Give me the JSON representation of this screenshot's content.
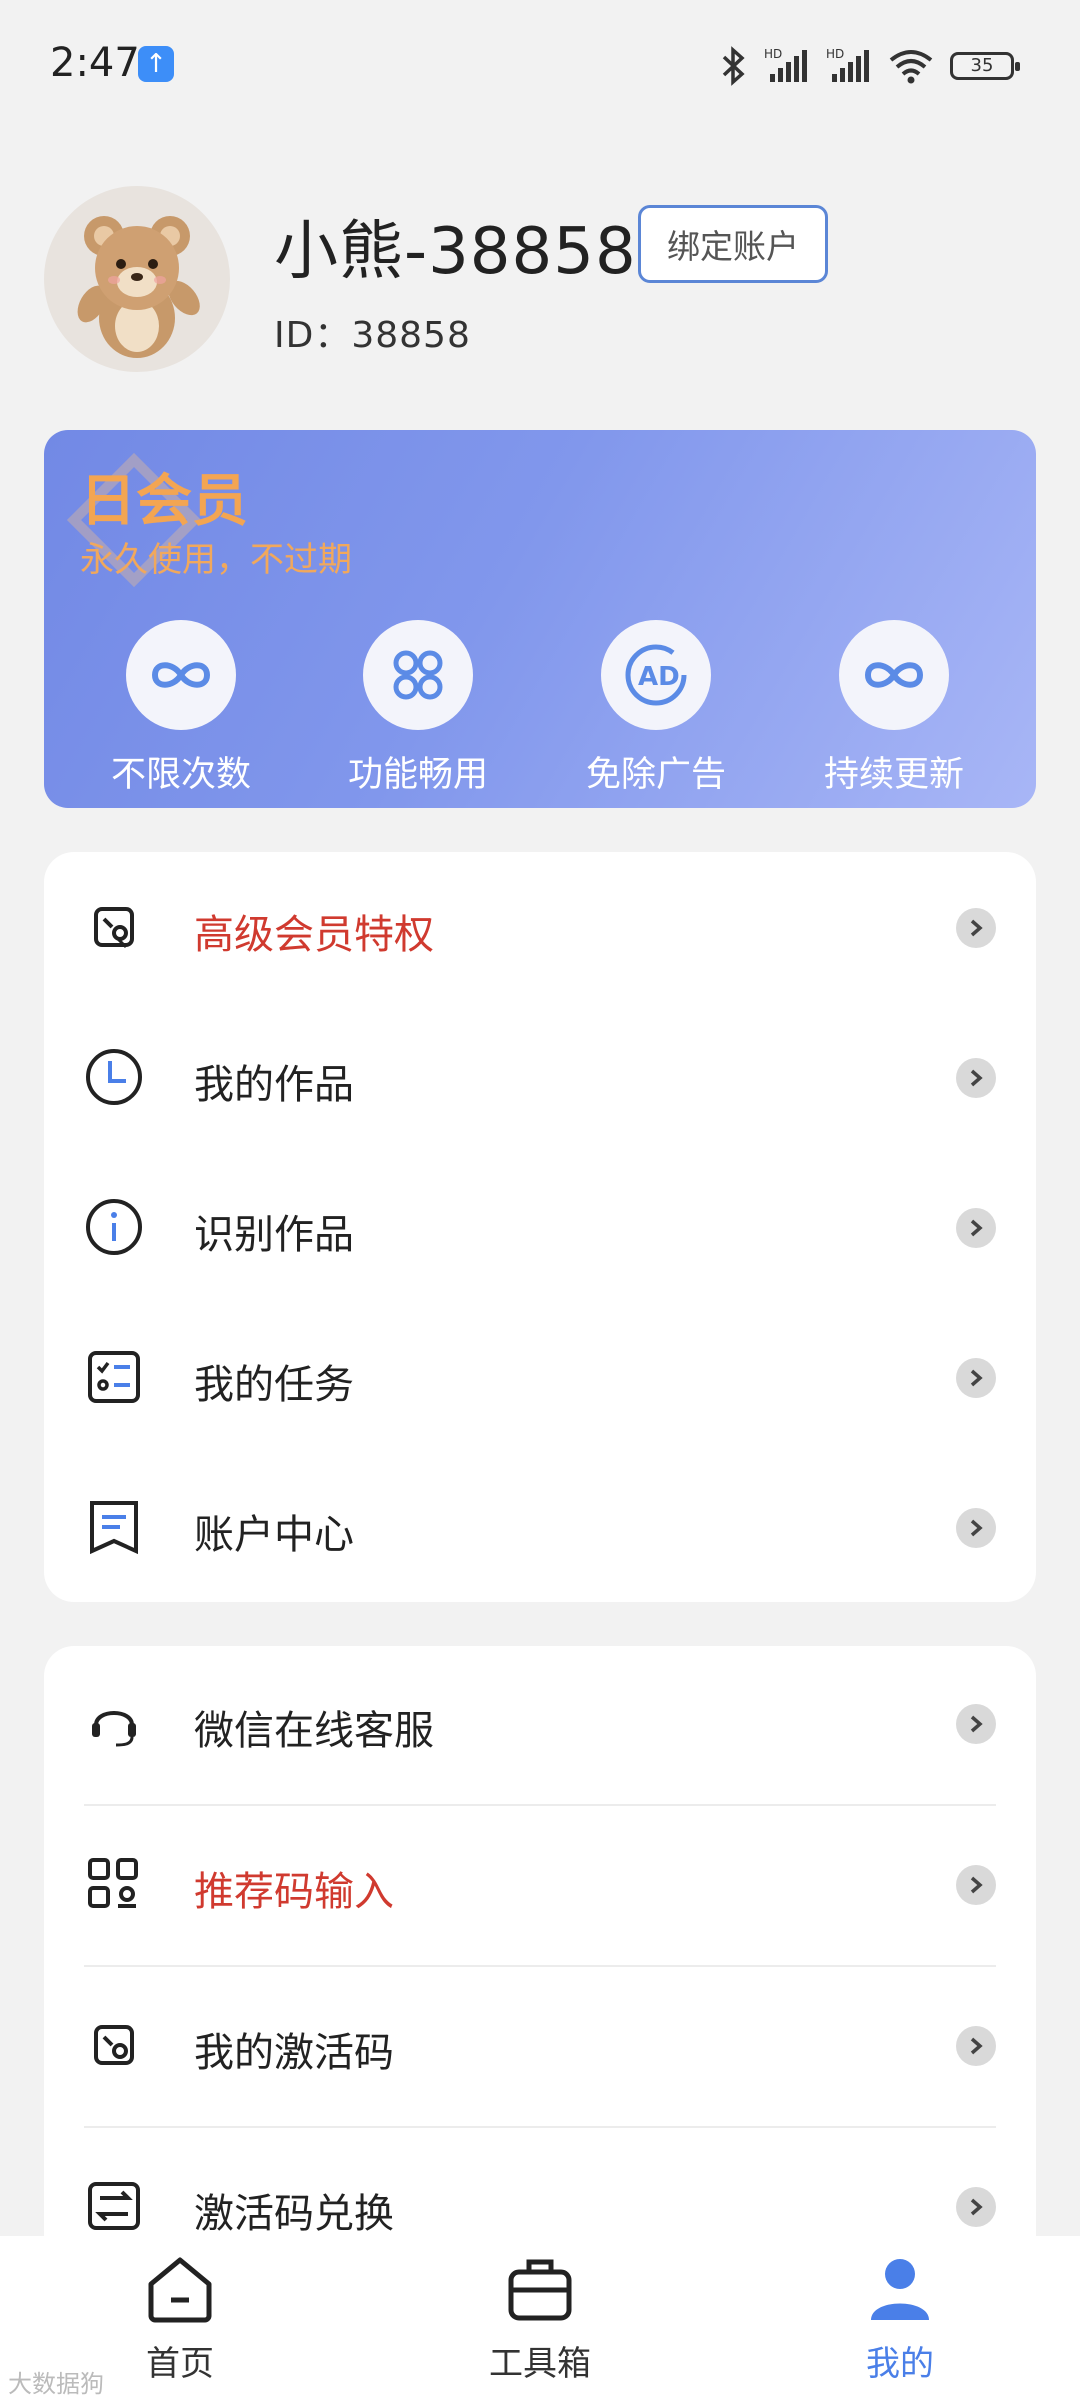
{
  "status_bar": {
    "time": "2:47",
    "battery": "35"
  },
  "profile": {
    "nickname": "小熊-38858",
    "bind_button": "绑定账户",
    "id_text": "ID：38858"
  },
  "vip": {
    "title": "日会员",
    "subtitle": "永久使用，不过期",
    "features": [
      {
        "label": "不限次数",
        "icon": "infinity-icon"
      },
      {
        "label": "功能畅用",
        "icon": "grid-icon"
      },
      {
        "label": "免除广告",
        "icon": "ad-block-icon"
      },
      {
        "label": "持续更新",
        "icon": "infinity-icon"
      }
    ]
  },
  "menu1": [
    {
      "label": "高级会员特权",
      "icon": "vip-card-icon",
      "highlight": true
    },
    {
      "label": "我的作品",
      "icon": "clock-icon"
    },
    {
      "label": "识别作品",
      "icon": "info-icon"
    },
    {
      "label": "我的任务",
      "icon": "checklist-icon"
    },
    {
      "label": "账户中心",
      "icon": "document-icon"
    }
  ],
  "menu2": [
    {
      "label": "微信在线客服",
      "icon": "headset-icon"
    },
    {
      "label": "推荐码输入",
      "icon": "qrcode-icon",
      "highlight": true
    },
    {
      "label": "我的激活码",
      "icon": "activation-card-icon"
    },
    {
      "label": "激活码兑换",
      "icon": "exchange-icon"
    }
  ],
  "bottom_nav": [
    {
      "label": "首页",
      "icon": "home-icon"
    },
    {
      "label": "工具箱",
      "icon": "toolbox-icon"
    },
    {
      "label": "我的",
      "icon": "person-icon",
      "active": true
    }
  ],
  "watermark": "大数据狗",
  "colors": {
    "accent": "#4a7fe8",
    "highlight_red": "#d03a2f",
    "vip_gold": "#f3a552"
  }
}
